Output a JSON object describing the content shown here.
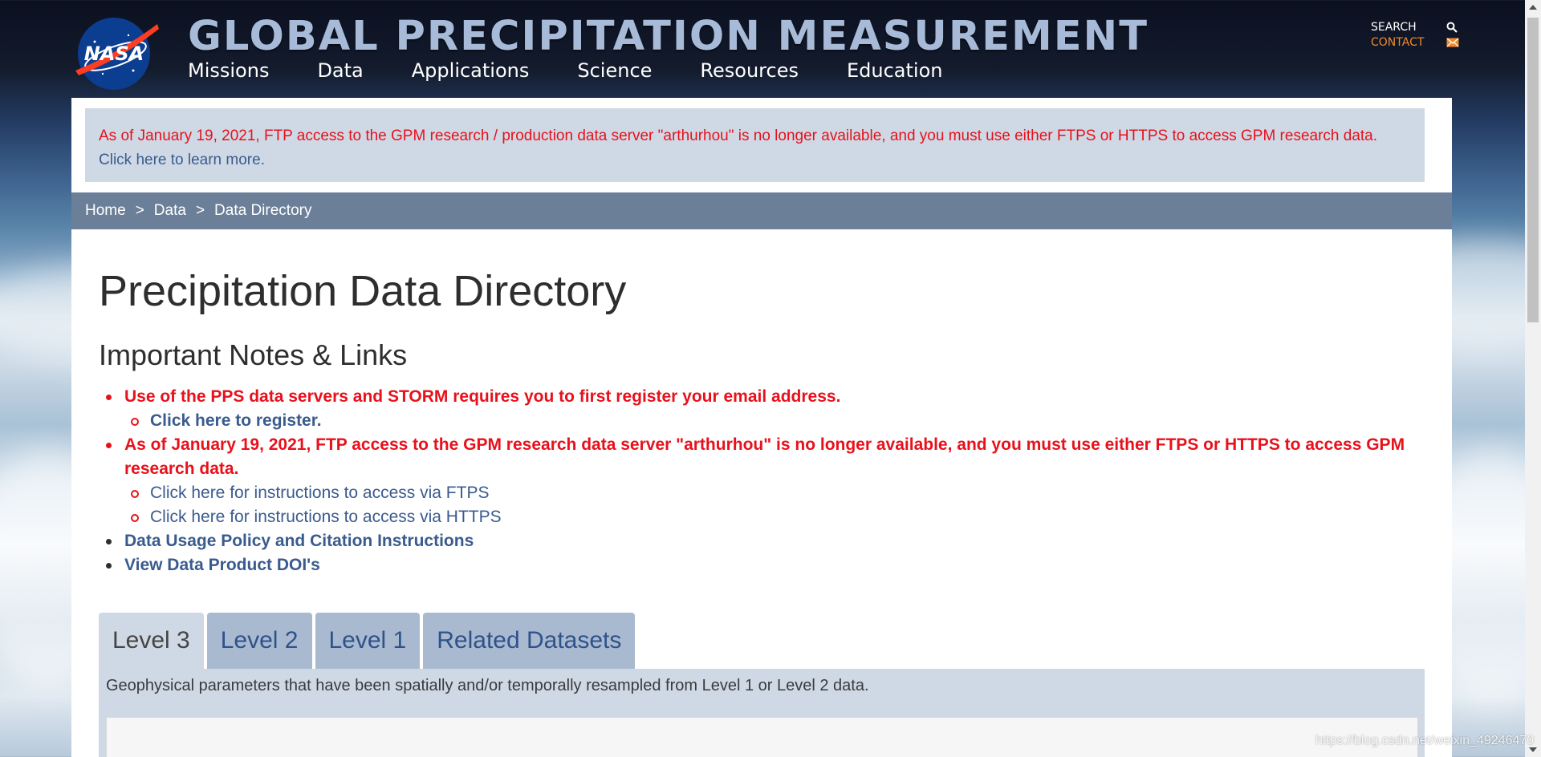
{
  "header": {
    "site_title": "GLOBAL PRECIPITATION MEASUREMENT",
    "logo_text": "NASA",
    "nav": [
      "Missions",
      "Data",
      "Applications",
      "Science",
      "Resources",
      "Education"
    ],
    "search_label": "SEARCH",
    "contact_label": "CONTACT"
  },
  "alert": {
    "message": "As of January 19, 2021, FTP access to the GPM research / production data server \"arthurhou\" is no longer available, and you must use either FTPS or HTTPS to access GPM research data.",
    "link": "Click here to learn more."
  },
  "breadcrumb": {
    "items": [
      "Home",
      "Data",
      "Data Directory"
    ],
    "separator": ">"
  },
  "page": {
    "title": "Precipitation Data Directory",
    "notes_heading": "Important Notes & Links"
  },
  "notes": {
    "register_notice": "Use of the PPS data servers and STORM requires you to first register your email address.",
    "register_link": "Click here to register.",
    "ftp_notice": "As of January 19, 2021, FTP access to the GPM research data server \"arthurhou\" is no longer available, and you must use either FTPS or HTTPS to access GPM research data.",
    "ftps_link": "Click here for instructions to access via FTPS",
    "https_link": "Click here for instructions to access via HTTPS",
    "policy_link": "Data Usage Policy and Citation Instructions",
    "doi_link": "View Data Product DOI's"
  },
  "tabs": {
    "items": [
      "Level 3",
      "Level 2",
      "Level 1",
      "Related Datasets"
    ],
    "active": "Level 3",
    "description": "Geophysical parameters that have been spatially and/or temporally resampled from Level 1 or Level 2 data."
  },
  "watermark": "https://blog.csdn.net/weixin_49246470",
  "colors": {
    "alert_red": "#e8111b",
    "link_blue": "#3a5b8e",
    "contact_orange": "#ef8a2c",
    "breadcrumb_bg": "#6c7f98",
    "panel_bg": "#cfd9e5"
  },
  "icons": {
    "search": "search-icon",
    "contact": "mail-icon"
  }
}
